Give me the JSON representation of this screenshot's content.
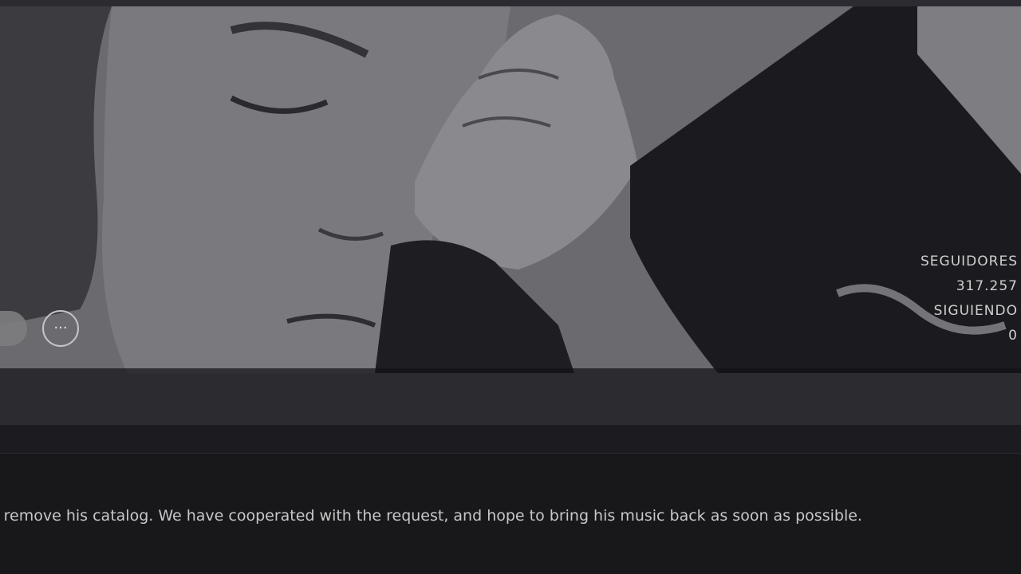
{
  "hero": {
    "image": "artist-header-photo"
  },
  "stats": {
    "followers_label": "SEGUIDORES",
    "followers_value": "317.257",
    "following_label": "SIGUIENDO",
    "following_value": "0"
  },
  "actions": {
    "more_icon": "more-dots-icon",
    "more_glyph": "···"
  },
  "notice": {
    "text": "o remove his catalog. We have cooperated with the request, and hope to bring his music back as soon as possible."
  },
  "colors": {
    "background": "#18181b",
    "hero_overlay": "#65656a",
    "text": "#c8c8c8"
  }
}
